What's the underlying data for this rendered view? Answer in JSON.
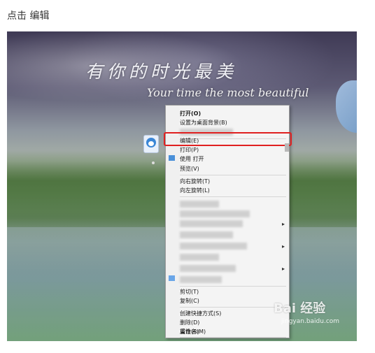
{
  "caption": "点击 编辑",
  "wallpaper": {
    "poem": "有你的时光最美",
    "subtitle": "Your time the most beautiful"
  },
  "context_menu": {
    "items": [
      {
        "label": "打开(O)",
        "bold": true
      },
      {
        "label": "设置为桌面背景(B)"
      },
      {
        "label": "编辑(E)",
        "highlighted": true
      },
      {
        "label": "打印(P)"
      },
      {
        "label": "使用 打开"
      },
      {
        "label": "预览(V)"
      },
      {
        "label": "向右旋转(T)"
      },
      {
        "label": "向左旋转(L)"
      },
      {
        "label": "剪切(T)"
      },
      {
        "label": "复制(C)"
      },
      {
        "label": "创建快捷方式(S)"
      },
      {
        "label": "删除(D)"
      },
      {
        "label": "重命名(M)"
      },
      {
        "label": "属性(R)"
      }
    ]
  },
  "watermark": {
    "text": "Bai 经验",
    "url": "jingyan.baidu.com"
  },
  "colors": {
    "highlight": "#e02020",
    "menu_bg": "#f4f4f4"
  },
  "icons": [
    "doraemon-file-icon",
    "submenu-arrow-icon"
  ]
}
